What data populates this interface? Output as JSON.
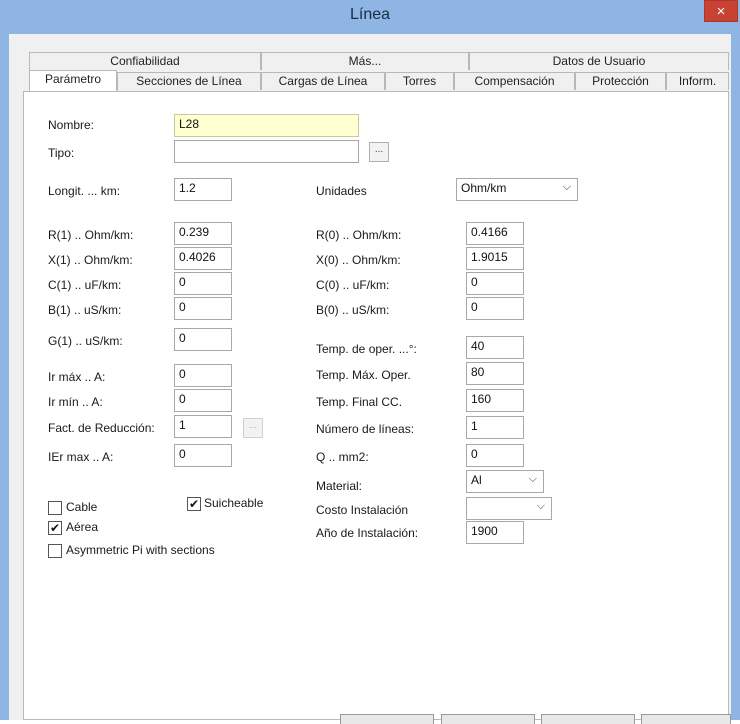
{
  "window": {
    "title": "Línea",
    "close_icon": "×"
  },
  "tabs_row1": [
    {
      "label": "Confiabilidad"
    },
    {
      "label": "Más..."
    },
    {
      "label": "Datos de Usuario"
    }
  ],
  "tabs_row2": [
    {
      "label": "Parámetro"
    },
    {
      "label": "Secciones de Línea"
    },
    {
      "label": "Cargas de Línea"
    },
    {
      "label": "Torres"
    },
    {
      "label": "Compensación"
    },
    {
      "label": "Protección"
    },
    {
      "label": "Inform."
    }
  ],
  "form": {
    "nombre": {
      "label": "Nombre:",
      "value": "L28"
    },
    "tipo": {
      "label": "Tipo:",
      "value": "",
      "button": "..."
    },
    "longitud": {
      "label": "Longit. ... km:",
      "value": "1.2"
    },
    "unidades": {
      "label": "Unidades",
      "value": "Ohm/km"
    },
    "left": [
      {
        "label": "R(1) .. Ohm/km:",
        "value": "0.239"
      },
      {
        "label": "X(1) .. Ohm/km:",
        "value": "0.4026"
      },
      {
        "label": "C(1) .. uF/km:",
        "value": "0"
      },
      {
        "label": "B(1) .. uS/km:",
        "value": "0"
      },
      {
        "label": "G(1) .. uS/km:",
        "value": "0"
      },
      {
        "label": "Ir máx .. A:",
        "value": "0"
      },
      {
        "label": "Ir mín .. A:",
        "value": "0"
      },
      {
        "label": "Fact. de Reducción:",
        "value": "1"
      },
      {
        "label": "IEr max .. A:",
        "value": "0"
      }
    ],
    "fact_button": "...",
    "right": [
      {
        "label": "R(0) .. Ohm/km:",
        "value": "0.4166"
      },
      {
        "label": "X(0) .. Ohm/km:",
        "value": "1.9015"
      },
      {
        "label": "C(0) .. uF/km:",
        "value": "0"
      },
      {
        "label": "B(0) .. uS/km:",
        "value": "0"
      },
      {
        "label": "Temp. de oper. ...°:",
        "value": "40"
      },
      {
        "label": "Temp. Máx. Oper.",
        "value": "80"
      },
      {
        "label": "Temp. Final CC.",
        "value": "160"
      },
      {
        "label": "Número de líneas:",
        "value": "1"
      },
      {
        "label": "Q .. mm2:",
        "value": "0"
      }
    ],
    "material": {
      "label": "Material:",
      "value": "Al"
    },
    "costo": {
      "label": "Costo Instalación",
      "value": ""
    },
    "anio": {
      "label": "Año de Instalación:",
      "value": "1900"
    },
    "checkboxes": {
      "cable": {
        "label": "Cable",
        "checked": false
      },
      "suicheable": {
        "label": "Suicheable",
        "checked": true
      },
      "aerea": {
        "label": "Aérea",
        "checked": true
      },
      "asym": {
        "label": "Asymmetric Pi with sections",
        "checked": false
      }
    },
    "check_mark": "✔",
    "chevron": "⌵"
  }
}
